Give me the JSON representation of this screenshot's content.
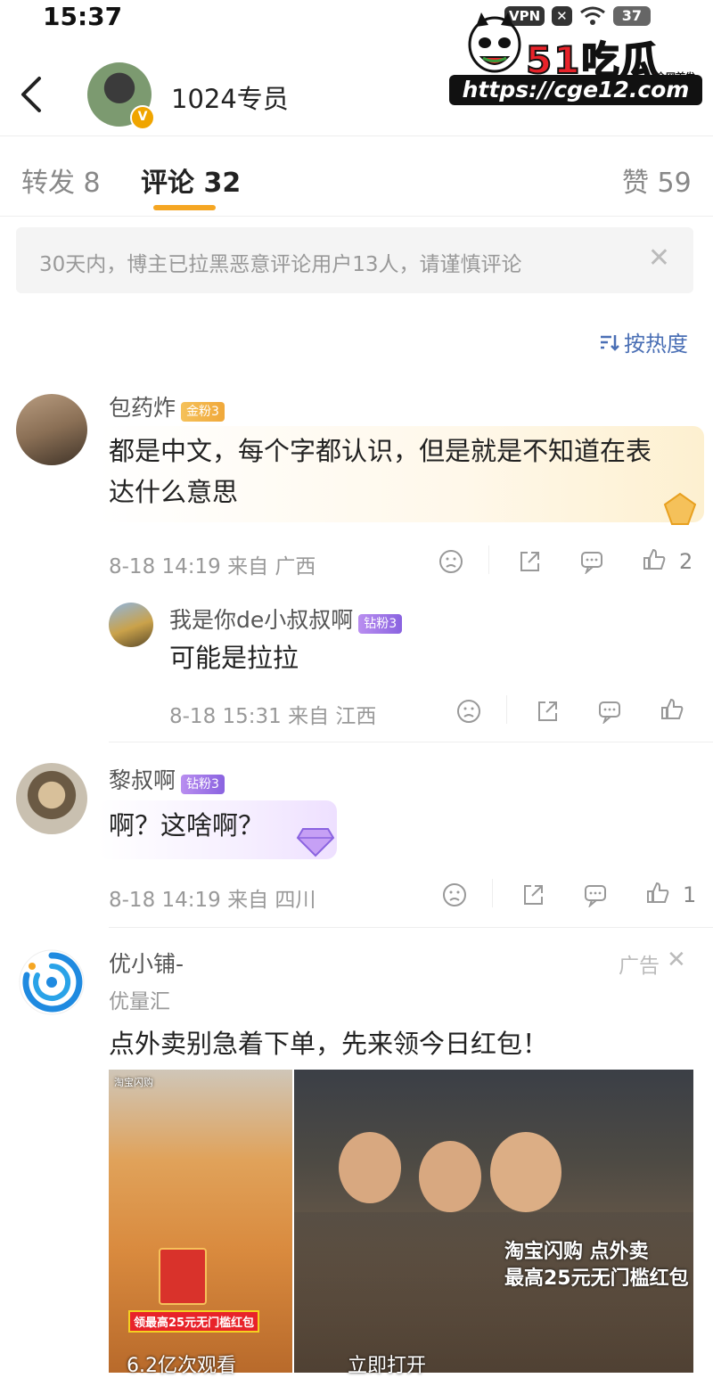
{
  "status_bar": {
    "time": "15:37",
    "vpn": "VPN",
    "battery": "37"
  },
  "watermark": {
    "logo": "51吃瓜",
    "sub": "全网首发",
    "url": "https://cge12.com"
  },
  "header": {
    "title": "1024专员",
    "badge": "V"
  },
  "tabs": [
    {
      "label": "转发 8"
    },
    {
      "label": "评论 32"
    },
    {
      "label": "赞 59"
    }
  ],
  "notice": {
    "text": "30天内，博主已拉黑恶意评论用户13人，请谨慎评论",
    "close": "✕"
  },
  "sort": {
    "label": "按热度"
  },
  "comments": [
    {
      "name": "包药炸",
      "badge": "金粉3",
      "text_line1": "都是中文，每个字都认识，但是就是不知道在表",
      "text_line2": "达什么意思",
      "meta": "8-18 14:19 来自 广西",
      "likes": "2",
      "reply": {
        "name": "我是你de小叔叔啊",
        "badge": "钻粉3",
        "text": "可能是拉拉",
        "meta": "8-18 15:31 来自 江西"
      }
    },
    {
      "name": "黎叔啊",
      "badge": "钻粉3",
      "text": "啊？这啥啊？",
      "meta": "8-18 14:19 来自 四川",
      "likes": "1"
    }
  ],
  "ad": {
    "name": "优小铺-",
    "sub": "优量汇",
    "label": "广告",
    "close": "✕",
    "text": "点外卖别急着下单，先来领今日红包！",
    "img1_top": "淘宝闪购",
    "img1_caption": "领最高25元无门槛红包",
    "img1_views": "6.2亿次观看",
    "img2_line1": "淘宝闪购 点外卖",
    "img2_line2": "最高25元无门槛红包",
    "img2_open": "立即打开"
  },
  "colors": {
    "accent": "#f5a623",
    "link": "#4a6fb5",
    "gold_badge": "#f0a83a",
    "purple_badge": "#8a63e0"
  }
}
